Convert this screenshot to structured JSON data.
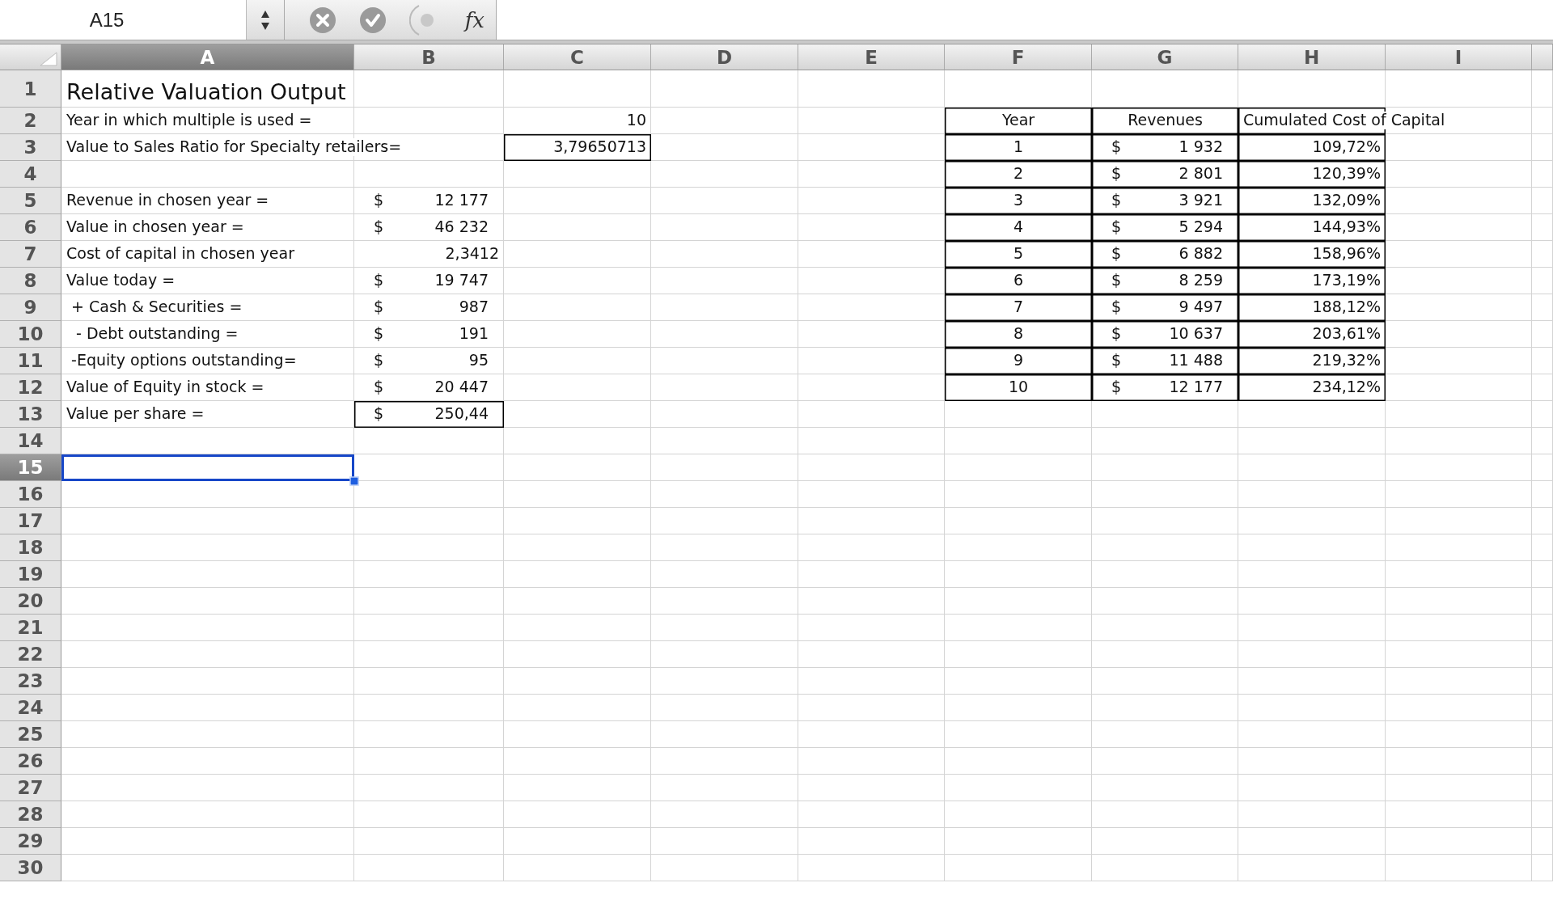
{
  "formula_bar": {
    "name_box": "A15",
    "function_label": "fx"
  },
  "columns": [
    {
      "label": "A",
      "selected": true
    },
    {
      "label": "B",
      "selected": false
    },
    {
      "label": "C",
      "selected": false
    },
    {
      "label": "D",
      "selected": false
    },
    {
      "label": "E",
      "selected": false
    },
    {
      "label": "F",
      "selected": false
    },
    {
      "label": "G",
      "selected": false
    },
    {
      "label": "H",
      "selected": false
    },
    {
      "label": "I",
      "selected": false
    }
  ],
  "rows": [
    {
      "number": "1",
      "selected": false,
      "cells": [
        {
          "kind": "title",
          "text": "Relative Valuation Output",
          "boxed": false,
          "selected": false
        }
      ]
    },
    {
      "number": "2",
      "selected": false,
      "cells": [
        {
          "kind": "label",
          "text": "Year in which multiple is used =",
          "boxed": false,
          "selected": false
        },
        null,
        {
          "kind": "number",
          "text": "10",
          "boxed": false,
          "selected": false
        },
        null,
        null,
        {
          "kind": "center",
          "text": "Year",
          "boxed": true,
          "selected": false
        },
        {
          "kind": "center",
          "text": "Revenues",
          "boxed": true,
          "selected": false
        },
        {
          "kind": "label",
          "text": "Cumulated Cost of Capital",
          "boxed": true,
          "selected": false
        }
      ]
    },
    {
      "number": "3",
      "selected": false,
      "cells": [
        {
          "kind": "label",
          "text": "Value to Sales Ratio for Specialty retailers=",
          "boxed": false,
          "selected": false
        },
        null,
        {
          "kind": "number",
          "text": "3,79650713",
          "boxed": true,
          "selected": false
        },
        null,
        null,
        {
          "kind": "center",
          "text": "1",
          "boxed": true,
          "selected": false
        },
        {
          "kind": "currency",
          "symbol": "$",
          "text": "1 932",
          "boxed": true,
          "selected": false
        },
        {
          "kind": "number",
          "text": "109,72%",
          "boxed": true,
          "selected": false
        }
      ]
    },
    {
      "number": "4",
      "selected": false,
      "cells": [
        null,
        null,
        null,
        null,
        null,
        {
          "kind": "center",
          "text": "2",
          "boxed": true,
          "selected": false
        },
        {
          "kind": "currency",
          "symbol": "$",
          "text": "2 801",
          "boxed": true,
          "selected": false
        },
        {
          "kind": "number",
          "text": "120,39%",
          "boxed": true,
          "selected": false
        }
      ]
    },
    {
      "number": "5",
      "selected": false,
      "cells": [
        {
          "kind": "label",
          "text": "Revenue in chosen year =",
          "boxed": false,
          "selected": false
        },
        {
          "kind": "currency",
          "symbol": "$",
          "text": "12 177",
          "boxed": false,
          "selected": false
        },
        null,
        null,
        null,
        {
          "kind": "center",
          "text": "3",
          "boxed": true,
          "selected": false
        },
        {
          "kind": "currency",
          "symbol": "$",
          "text": "3 921",
          "boxed": true,
          "selected": false
        },
        {
          "kind": "number",
          "text": "132,09%",
          "boxed": true,
          "selected": false
        }
      ]
    },
    {
      "number": "6",
      "selected": false,
      "cells": [
        {
          "kind": "label",
          "text": "Value in chosen year =",
          "boxed": false,
          "selected": false
        },
        {
          "kind": "currency",
          "symbol": "$",
          "text": "46 232",
          "boxed": false,
          "selected": false
        },
        null,
        null,
        null,
        {
          "kind": "center",
          "text": "4",
          "boxed": true,
          "selected": false
        },
        {
          "kind": "currency",
          "symbol": "$",
          "text": "5 294",
          "boxed": true,
          "selected": false
        },
        {
          "kind": "number",
          "text": "144,93%",
          "boxed": true,
          "selected": false
        }
      ]
    },
    {
      "number": "7",
      "selected": false,
      "cells": [
        {
          "kind": "label",
          "text": "Cost of capital in chosen year",
          "boxed": false,
          "selected": false
        },
        {
          "kind": "number",
          "text": "2,3412",
          "boxed": false,
          "selected": false
        },
        null,
        null,
        null,
        {
          "kind": "center",
          "text": "5",
          "boxed": true,
          "selected": false
        },
        {
          "kind": "currency",
          "symbol": "$",
          "text": "6 882",
          "boxed": true,
          "selected": false
        },
        {
          "kind": "number",
          "text": "158,96%",
          "boxed": true,
          "selected": false
        }
      ]
    },
    {
      "number": "8",
      "selected": false,
      "cells": [
        {
          "kind": "label",
          "text": "Value today =",
          "boxed": false,
          "selected": false
        },
        {
          "kind": "currency",
          "symbol": "$",
          "text": "19 747",
          "boxed": false,
          "selected": false
        },
        null,
        null,
        null,
        {
          "kind": "center",
          "text": "6",
          "boxed": true,
          "selected": false
        },
        {
          "kind": "currency",
          "symbol": "$",
          "text": "8 259",
          "boxed": true,
          "selected": false
        },
        {
          "kind": "number",
          "text": "173,19%",
          "boxed": true,
          "selected": false
        }
      ]
    },
    {
      "number": "9",
      "selected": false,
      "cells": [
        {
          "kind": "label",
          "text": " + Cash & Securities =",
          "boxed": false,
          "selected": false
        },
        {
          "kind": "currency",
          "symbol": "$",
          "text": "987",
          "boxed": false,
          "selected": false
        },
        null,
        null,
        null,
        {
          "kind": "center",
          "text": "7",
          "boxed": true,
          "selected": false
        },
        {
          "kind": "currency",
          "symbol": "$",
          "text": "9 497",
          "boxed": true,
          "selected": false
        },
        {
          "kind": "number",
          "text": "188,12%",
          "boxed": true,
          "selected": false
        }
      ]
    },
    {
      "number": "10",
      "selected": false,
      "cells": [
        {
          "kind": "label",
          "text": "  - Debt outstanding =",
          "boxed": false,
          "selected": false
        },
        {
          "kind": "currency",
          "symbol": "$",
          "text": "191",
          "boxed": false,
          "selected": false
        },
        null,
        null,
        null,
        {
          "kind": "center",
          "text": "8",
          "boxed": true,
          "selected": false
        },
        {
          "kind": "currency",
          "symbol": "$",
          "text": "10 637",
          "boxed": true,
          "selected": false
        },
        {
          "kind": "number",
          "text": "203,61%",
          "boxed": true,
          "selected": false
        }
      ]
    },
    {
      "number": "11",
      "selected": false,
      "cells": [
        {
          "kind": "label",
          "text": " -Equity options outstanding=",
          "boxed": false,
          "selected": false
        },
        {
          "kind": "currency",
          "symbol": "$",
          "text": "95",
          "boxed": false,
          "selected": false
        },
        null,
        null,
        null,
        {
          "kind": "center",
          "text": "9",
          "boxed": true,
          "selected": false
        },
        {
          "kind": "currency",
          "symbol": "$",
          "text": "11 488",
          "boxed": true,
          "selected": false
        },
        {
          "kind": "number",
          "text": "219,32%",
          "boxed": true,
          "selected": false
        }
      ]
    },
    {
      "number": "12",
      "selected": false,
      "cells": [
        {
          "kind": "label",
          "text": "Value of Equity in stock =",
          "boxed": false,
          "selected": false
        },
        {
          "kind": "currency",
          "symbol": "$",
          "text": "20 447",
          "boxed": false,
          "selected": false
        },
        null,
        null,
        null,
        {
          "kind": "center",
          "text": "10",
          "boxed": true,
          "selected": false
        },
        {
          "kind": "currency",
          "symbol": "$",
          "text": "12 177",
          "boxed": true,
          "selected": false
        },
        {
          "kind": "number",
          "text": "234,12%",
          "boxed": true,
          "selected": false
        }
      ]
    },
    {
      "number": "13",
      "selected": false,
      "cells": [
        {
          "kind": "label",
          "text": "Value per share =",
          "boxed": false,
          "selected": false
        },
        {
          "kind": "currency",
          "symbol": "$",
          "text": "250,44",
          "boxed": true,
          "selected": false
        }
      ]
    },
    {
      "number": "14",
      "selected": false,
      "cells": []
    },
    {
      "number": "15",
      "selected": true,
      "cells": [
        {
          "kind": "blank",
          "selected": true
        }
      ]
    },
    {
      "number": "16",
      "selected": false,
      "cells": []
    },
    {
      "number": "17",
      "selected": false,
      "cells": []
    },
    {
      "number": "18",
      "selected": false,
      "cells": []
    },
    {
      "number": "19",
      "selected": false,
      "cells": []
    },
    {
      "number": "20",
      "selected": false,
      "cells": []
    },
    {
      "number": "21",
      "selected": false,
      "cells": []
    },
    {
      "number": "22",
      "selected": false,
      "cells": []
    },
    {
      "number": "23",
      "selected": false,
      "cells": []
    },
    {
      "number": "24",
      "selected": false,
      "cells": []
    },
    {
      "number": "25",
      "selected": false,
      "cells": []
    },
    {
      "number": "26",
      "selected": false,
      "cells": []
    },
    {
      "number": "27",
      "selected": false,
      "cells": []
    },
    {
      "number": "28",
      "selected": false,
      "cells": []
    },
    {
      "number": "29",
      "selected": false,
      "cells": []
    },
    {
      "number": "30",
      "selected": false,
      "cells": []
    }
  ]
}
